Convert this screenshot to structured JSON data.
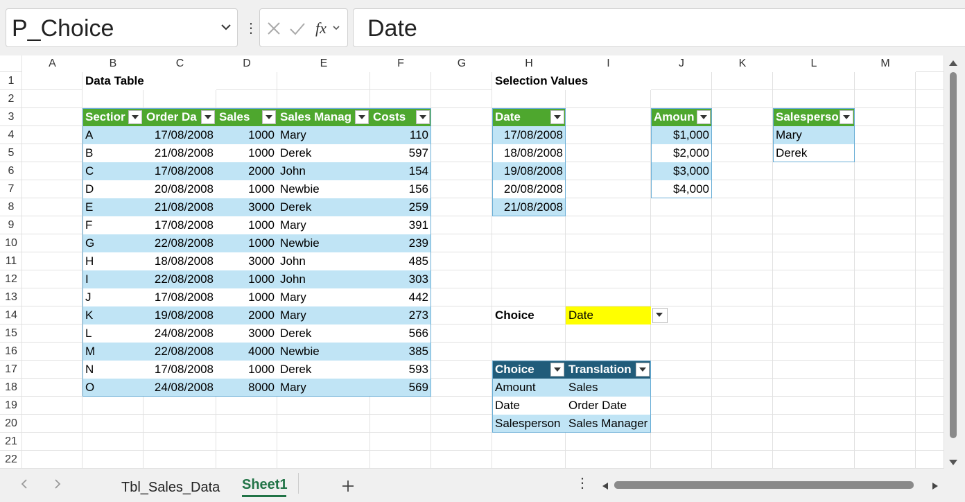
{
  "name_box": {
    "value": "P_Choice"
  },
  "formula_bar": {
    "value": "Date"
  },
  "columns": [
    "A",
    "B",
    "C",
    "D",
    "E",
    "F",
    "G",
    "H",
    "I",
    "J",
    "K",
    "L",
    "M"
  ],
  "rows": [
    "1",
    "2",
    "3",
    "4",
    "5",
    "6",
    "7",
    "8",
    "9",
    "10",
    "11",
    "12",
    "13",
    "14",
    "15",
    "16",
    "17",
    "18",
    "19",
    "20",
    "21",
    "22"
  ],
  "titles": {
    "data_table": "Data Table",
    "selection_values": "Selection Values"
  },
  "data_table": {
    "headers": [
      "Sectior",
      "Order Da",
      "Sales",
      "Sales Manag",
      "Costs"
    ],
    "rows": [
      [
        "A",
        "17/08/2008",
        "1000",
        "Mary",
        "110"
      ],
      [
        "B",
        "21/08/2008",
        "1000",
        "Derek",
        "597"
      ],
      [
        "C",
        "17/08/2008",
        "2000",
        "John",
        "154"
      ],
      [
        "D",
        "20/08/2008",
        "1000",
        "Newbie",
        "156"
      ],
      [
        "E",
        "21/08/2008",
        "3000",
        "Derek",
        "259"
      ],
      [
        "F",
        "17/08/2008",
        "1000",
        "Mary",
        "391"
      ],
      [
        "G",
        "22/08/2008",
        "1000",
        "Newbie",
        "239"
      ],
      [
        "H",
        "18/08/2008",
        "3000",
        "John",
        "485"
      ],
      [
        "I",
        "22/08/2008",
        "1000",
        "John",
        "303"
      ],
      [
        "J",
        "17/08/2008",
        "1000",
        "Mary",
        "442"
      ],
      [
        "K",
        "19/08/2008",
        "2000",
        "Mary",
        "273"
      ],
      [
        "L",
        "24/08/2008",
        "3000",
        "Derek",
        "566"
      ],
      [
        "M",
        "22/08/2008",
        "4000",
        "Newbie",
        "385"
      ],
      [
        "N",
        "17/08/2008",
        "1000",
        "Derek",
        "593"
      ],
      [
        "O",
        "24/08/2008",
        "8000",
        "Mary",
        "569"
      ]
    ]
  },
  "date_table": {
    "header": "Date",
    "values": [
      "17/08/2008",
      "18/08/2008",
      "19/08/2008",
      "20/08/2008",
      "21/08/2008"
    ]
  },
  "amount_table": {
    "header": "Amoun",
    "values": [
      "$1,000",
      "$2,000",
      "$3,000",
      "$4,000"
    ]
  },
  "salesperson_table": {
    "header": "Salesperso",
    "values": [
      "Mary",
      "Derek"
    ]
  },
  "choice": {
    "label": "Choice",
    "value": "Date"
  },
  "translation_table": {
    "headers": [
      "Choice",
      "Translation"
    ],
    "rows": [
      [
        "Amount",
        "Sales"
      ],
      [
        "Date",
        "Order Date"
      ],
      [
        "Salesperson",
        "Sales Manager"
      ]
    ]
  },
  "sheet_tabs": [
    "Tbl_Sales_Data",
    "Sheet1"
  ],
  "active_tab": "Sheet1",
  "colors": {
    "green_header": "#4ea72e",
    "navy_header": "#215c7a",
    "band": "#c0e4f5",
    "highlight": "#ffff00",
    "active_tab": "#217346"
  }
}
